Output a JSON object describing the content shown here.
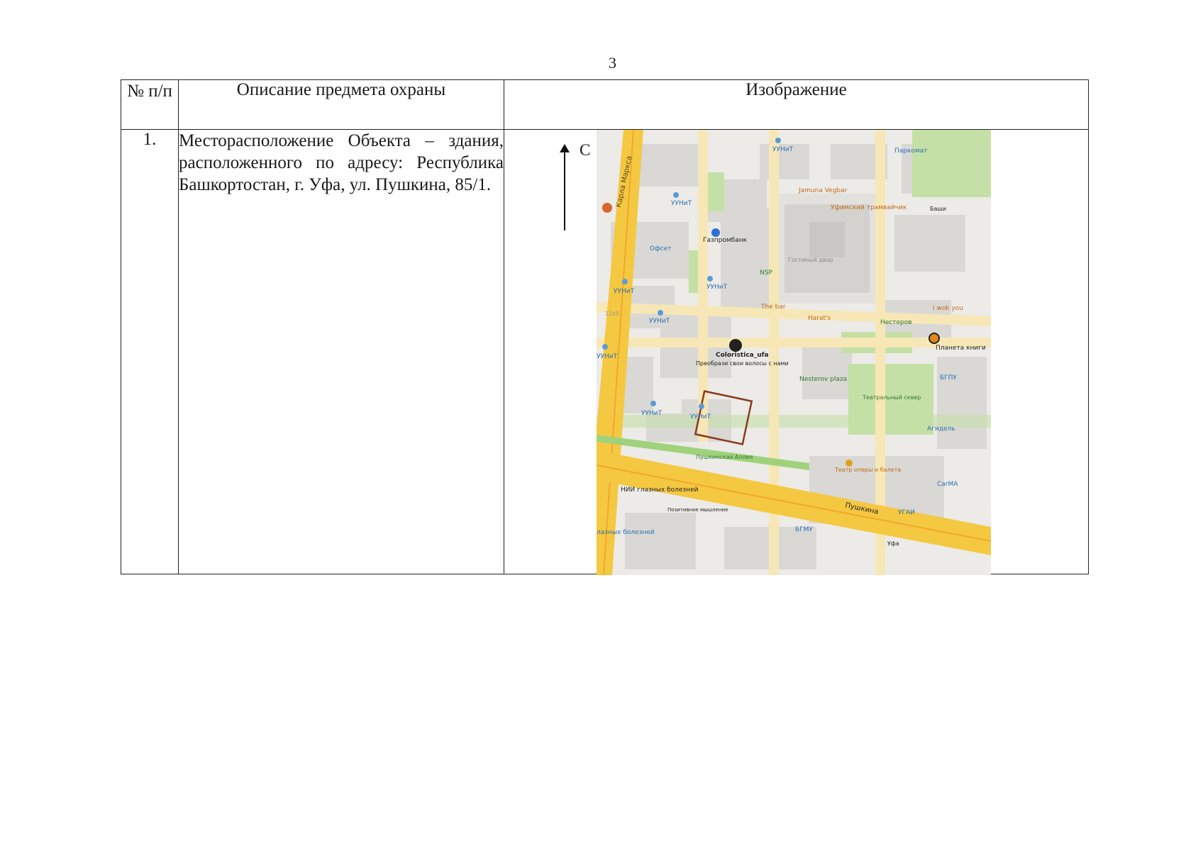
{
  "page_number": "3",
  "table": {
    "headers": {
      "num": "№ п/п",
      "description": "Описание предмета охраны",
      "image": "Изображение"
    },
    "rows": [
      {
        "num": "1.",
        "description": "Месторасположение Объекта – здания, расположенного по адресу: Республика Башкортостан, г. Уфа, ул. Пушкина, 85/1."
      }
    ]
  },
  "map": {
    "north_label": "С",
    "labels": {
      "karla_marksa": "Карла Маркса",
      "uunit_1": "УУНиТ",
      "uunit_2": "УУНиТ",
      "uunit_3": "УУНиТ",
      "uunit_4": "УУНиТ",
      "uunit_5": "УУНиТ",
      "uunit_6": "УУНиТ",
      "uunit_7": "УУНиТ",
      "uunit_8": "УУНиТ",
      "parkomat": "Паркомат",
      "jamuna": "Jamuna Vegbar",
      "tramvaynik": "Уфимский трамвайчик",
      "gazprombank": "Газпромбанк",
      "ofset": "Офсет",
      "gostiny": "Гостиный двор",
      "nsp": "NSP",
      "the_bar": "The bar",
      "harat": "Harat's",
      "nesterov": "Нестеров",
      "wok": "I wok you",
      "planeta": "Планета книги",
      "coloristica": "Coloristica_ufa",
      "coloristica_sub": "Преобрази свои волосы с нами",
      "nesterov_plaza": "Nesterov plaza",
      "bgpu": "БГПУ",
      "teatr_skver": "Театральный сквер",
      "agidel": "Агидель",
      "pushk_alley": "Пушкинская Аллея",
      "teatr_opera": "Театр оперы и балета",
      "carma": "CarMA",
      "nii": "НИИ глазных болезней",
      "pozitiv": "Позитивное мышление",
      "pushkina": "Пушкина",
      "ugai": "УГАИ",
      "bgmu": "БГМУ",
      "eye": "лазных болезней",
      "ufa": "Уфа",
      "bashi": "Баши",
      "l12x5": "12х5"
    }
  }
}
